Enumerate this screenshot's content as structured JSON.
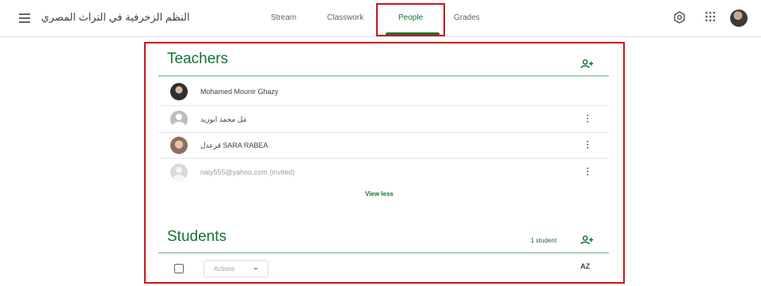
{
  "header": {
    "class_title": "النظم الزخرفية في التراث المصري",
    "tabs": [
      {
        "label": "Stream"
      },
      {
        "label": "Classwork"
      },
      {
        "label": "People"
      },
      {
        "label": "Grades"
      }
    ],
    "active_tab": "People",
    "icons": [
      "menu-icon",
      "settings-icon",
      "apps-grid-icon",
      "account-avatar"
    ]
  },
  "teachers": {
    "title": "Teachers",
    "members": [
      {
        "name": "Mohamed Mounir Ghazy",
        "avatar": "photo"
      },
      {
        "name": "مَل محمد ابوزيد",
        "avatar": "generic"
      },
      {
        "name": "قرعدل SARA RABEA",
        "avatar": "photo"
      },
      {
        "name": "naly555@yahoo.com  (invited)",
        "avatar": "generic-invited"
      }
    ],
    "view_less": "View less"
  },
  "students": {
    "title": "Students",
    "count": "1 student",
    "actions_label": "Actions",
    "sort_label": "AZ"
  },
  "colors": {
    "accent": "#137333",
    "highlight": "#c4151c"
  }
}
